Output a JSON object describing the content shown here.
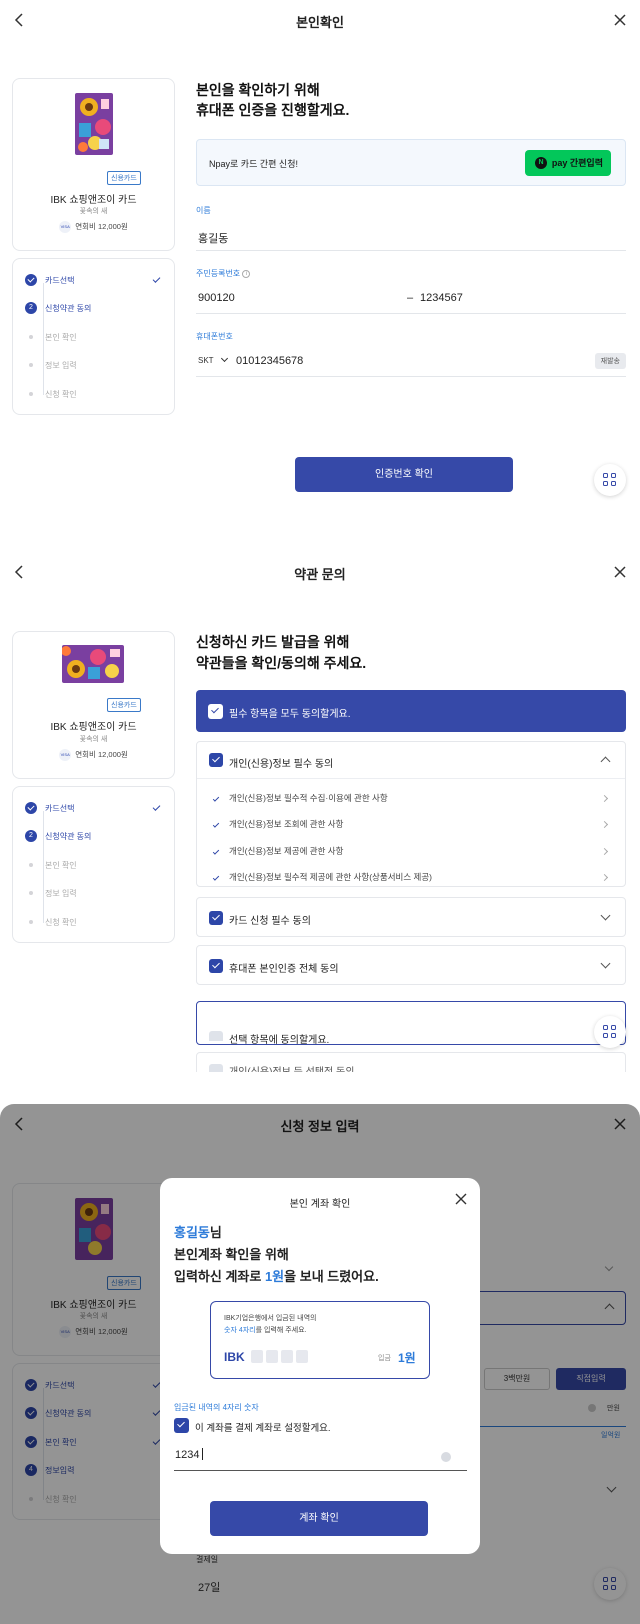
{
  "card": {
    "badge": "신용카드",
    "name": "IBK 쇼핑앤조이 카드",
    "sub": "꽃속의 새",
    "fee": "연회비 12,000원",
    "visa": "VISA"
  },
  "steps": {
    "s1": "카드선택",
    "s2": "신청약관 동의",
    "s3": "본인 확인",
    "s4": "정보 입력",
    "s4b": "정보입력",
    "s5": "신청 확인",
    "n2": "2",
    "n4": "4"
  },
  "screen1": {
    "title": "본인확인",
    "heading1": "본인을 확인하기 위해",
    "heading2": "휴대폰 인증을 진행할게요.",
    "npay_text": "Npay로 카드 간편 신청!",
    "npay_button": "pay 간편입력",
    "npay_logo": "N",
    "name_label": "이름",
    "name_value": "홍길동",
    "rrn_label": "주민등록번호",
    "rrn_front": "900120",
    "rrn_back": "1234567",
    "rrn_dash": "–",
    "phone_label": "휴대폰번호",
    "carrier": "SKT",
    "phone_value": "01012345678",
    "resend": "재발송",
    "confirm_button": "인증번호 확인"
  },
  "screen2": {
    "title": "약관 문의",
    "heading1": "신청하신 카드 발급을 위해",
    "heading2": "약관들을 확인/동의해 주세요.",
    "all_agree": "필수 항목을 모두 동의할게요.",
    "sec1": "개인(신용)정보 필수 동의",
    "sub_items": [
      "개인(신용)정보 필수적 수집·이용에 관한 사항",
      "개인(신용)정보 조회에 관한 사항",
      "개인(신용)정보 제공에 관한 사항",
      "개인(신용)정보 필수적 제공에 관한 사항(상품서비스 제공)"
    ],
    "sec2": "카드 신청 필수 동의",
    "sec3": "휴대폰 본인인증 전체 동의",
    "optional": "선택 항목에 동의할게요.",
    "optional_sub": "개인(신용)정보 등 선택적 동의"
  },
  "screen3": {
    "title": "신청 정보 입력",
    "bg_limit_a": "3백만원",
    "bg_limit_b": "직접입력",
    "bg_unit": "만원",
    "bg_hint": "일억원",
    "bg_payday_label": "결제일",
    "bg_payday_value": "27일",
    "modal": {
      "title": "본인 계좌 확인",
      "name": "홍길동",
      "name_suffix": "님",
      "line2": "본인계좌 확인을 위해",
      "line3_pre": "입력하신 계좌로 ",
      "line3_amount": "1원",
      "line3_post": "을 보내 드렸어요.",
      "box_line1": "IBK기업은행에서 입금된 내역의",
      "box_line2_em": "숫자 4자리",
      "box_line2_post": "를 입력해 주세요.",
      "bank": "IBK",
      "deposit_label": "입금",
      "deposit_amount": "1원",
      "field_label": "입금된 내역의 4자리 숫자",
      "checkbox_label": "이 계좌를 결제 계좌로 설정할게요.",
      "code_value": "1234",
      "confirm_button": "계좌 확인"
    }
  },
  "colors": {
    "primary": "#3649a8",
    "accent": "#2d7bd9",
    "npay": "#03c75a"
  }
}
